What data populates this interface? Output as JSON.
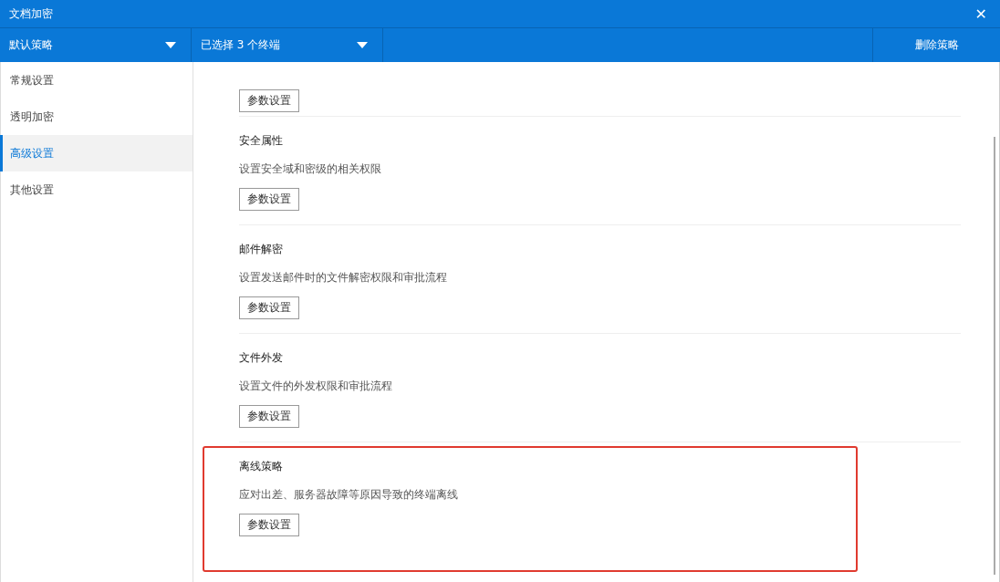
{
  "window": {
    "title": "文档加密",
    "close": "✕"
  },
  "toolbar": {
    "policy": "默认策略",
    "terminals": "已选择 3 个终端",
    "delete": "删除策略"
  },
  "sidebar": {
    "items": [
      {
        "label": "常规设置",
        "selected": false
      },
      {
        "label": "透明加密",
        "selected": false
      },
      {
        "label": "高级设置",
        "selected": true
      },
      {
        "label": "其他设置",
        "selected": false
      }
    ]
  },
  "sections": [
    {
      "button": "参数设置",
      "highlighted": false
    },
    {
      "title": "安全属性",
      "description": "设置安全域和密级的相关权限",
      "button": "参数设置",
      "highlighted": false
    },
    {
      "title": "邮件解密",
      "description": "设置发送邮件时的文件解密权限和审批流程",
      "button": "参数设置",
      "highlighted": false
    },
    {
      "title": "文件外发",
      "description": "设置文件的外发权限和审批流程",
      "button": "参数设置",
      "highlighted": false
    },
    {
      "title": "离线策略",
      "description": "应对出差、服务器故障等原因导致的终端离线",
      "button": "参数设置",
      "highlighted": true
    }
  ]
}
